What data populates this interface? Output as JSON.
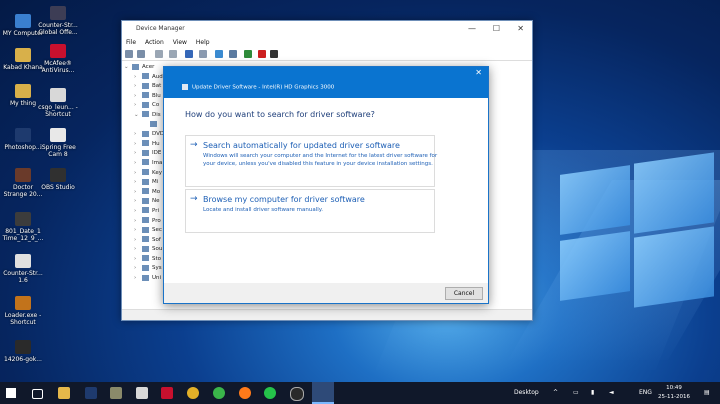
{
  "desktop": {
    "icons": [
      {
        "label": "MY Computer",
        "color": "#3a7fcf"
      },
      {
        "label": "Kabad Khana",
        "color": "#d8b04a"
      },
      {
        "label": "My thing",
        "color": "#d8b04a"
      },
      {
        "label": "Photoshop...",
        "color": "#1e3a6e"
      },
      {
        "label": "Doctor Strange 20...",
        "color": "#6a3a2a"
      },
      {
        "label": "801_Date_1 Time_12_9_...",
        "color": "#3c3c3c"
      },
      {
        "label": "Counter-Str... 1.6",
        "color": "#e0e0e0"
      },
      {
        "label": "Loader.exe - Shortcut",
        "color": "#c2731b"
      },
      {
        "label": "14206-gok...",
        "color": "#2a2a2a"
      },
      {
        "label": "Counter-Str... Global Offe...",
        "color": "#3d3d55"
      },
      {
        "label": "McAfee® AntiVirus...",
        "color": "#c8102e"
      },
      {
        "label": "csgo_leun... - Shortcut",
        "color": "#d8d8d8"
      },
      {
        "label": "iSpring Free Cam 8",
        "color": "#e8e8e8"
      },
      {
        "label": "OBS Studio",
        "color": "#303030"
      }
    ]
  },
  "device_manager": {
    "title": "Device Manager",
    "menu": [
      "File",
      "Action",
      "View",
      "Help"
    ],
    "window_controls": [
      "—",
      "☐",
      "✕"
    ],
    "tree": {
      "root": "Acer",
      "items": [
        "Aud",
        "Bat",
        "Blu",
        "Co",
        "Dis",
        "",
        "DVD",
        "Hu",
        "IDE",
        "Ima",
        "Key",
        "Mi",
        "Mo",
        "Ne",
        "Pri",
        "Pro",
        "Sec",
        "Sof",
        "Sou",
        "Sto",
        "Sys",
        "Uni"
      ]
    }
  },
  "dialog": {
    "subtitle": "Update Driver Software - Intel(R) HD Graphics 3000",
    "close": "✕",
    "question": "How do you want to search for driver software?",
    "option1": {
      "title": "Search automatically for updated driver software",
      "desc": "Windows will search your computer and the Internet for the latest driver software for your device, unless you've disabled this feature in your device installation settings."
    },
    "option2": {
      "title": "Browse my computer for driver software",
      "desc": "Locate and install driver software manually."
    },
    "arrow": "→",
    "cancel": "Cancel"
  },
  "taskbar": {
    "desktop_label": "Desktop",
    "lang": "ENG",
    "time": "10:49",
    "date": "25-11-2016"
  },
  "colors": {
    "accent": "#0a74d0",
    "link": "#1d5fb5"
  }
}
